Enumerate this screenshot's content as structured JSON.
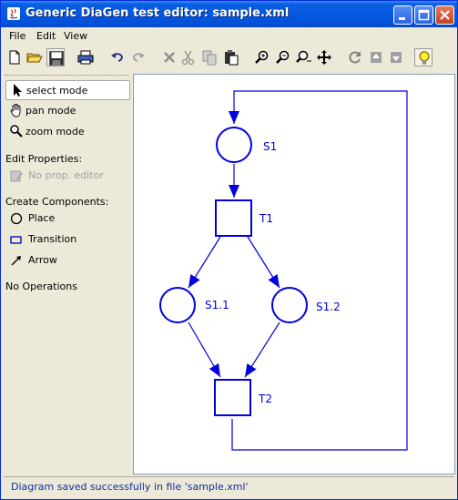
{
  "window": {
    "title": "Generic DiaGen test editor: sample.xml"
  },
  "menu": {
    "items": [
      "File",
      "Edit",
      "View"
    ]
  },
  "toolbar": {
    "icons": [
      "new-file-icon",
      "open-folder-icon",
      "save-icon",
      "print-icon",
      "undo-icon",
      "redo-icon",
      "delete-icon",
      "cut-icon",
      "copy-icon",
      "paste-icon",
      "zoom-in-icon",
      "zoom-out-icon",
      "zoom-fit-icon",
      "move-icon",
      "refresh-icon",
      "back-icon",
      "forward-icon",
      "lightbulb-icon"
    ]
  },
  "modes": {
    "select": "select mode",
    "pan": "pan mode",
    "zoom": "zoom mode"
  },
  "sections": {
    "edit_properties": "Edit Properties:",
    "no_prop_editor": "No prop. editor",
    "create_components": "Create Components:",
    "no_operations": "No Operations"
  },
  "components": {
    "place": "Place",
    "transition": "Transition",
    "arrow": "Arrow"
  },
  "diagram": {
    "color": "#0000e0",
    "places": {
      "s1": "S1",
      "s1_1": "S1.1",
      "s1_2": "S1.2"
    },
    "transitions": {
      "t1": "T1",
      "t2": "T2"
    }
  },
  "status": {
    "message": "Diagram saved successfully in file 'sample.xml'"
  }
}
